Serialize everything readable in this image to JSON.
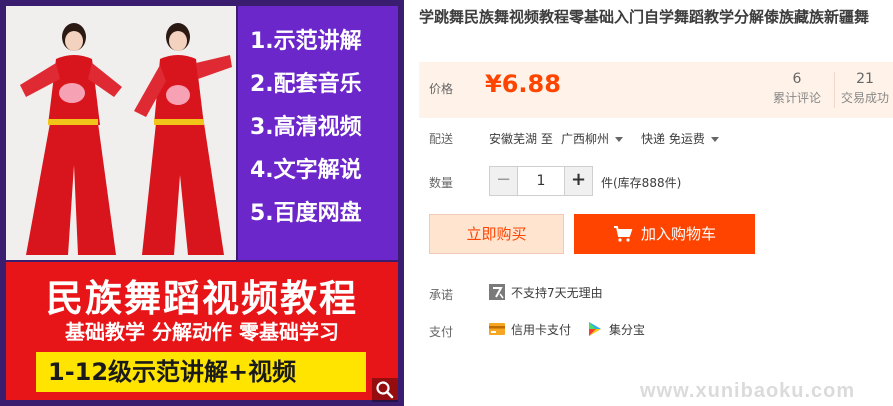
{
  "image": {
    "steps": [
      "1.示范讲解",
      "2.配套音乐",
      "3.高清视频",
      "4.文字解说",
      "5.百度网盘"
    ],
    "banner_title": "民族舞蹈视频教程",
    "banner_subtitle": "基础教学 分解动作 零基础学习",
    "banner_pill": "1-12级示范讲解+视频",
    "zoom_icon": "magnifier-icon"
  },
  "product": {
    "title": "学跳舞民族舞视频教程零基础入门自学舞蹈教学分解傣族藏族新疆舞",
    "price_label": "价格",
    "price": "¥6.88",
    "reviews_count": "6",
    "reviews_label": "累计评论",
    "sales_count": "21",
    "sales_label": "交易成功"
  },
  "shipping": {
    "label": "配送",
    "from": "安徽芜湖 至",
    "to": "广西柳州",
    "method": "快递 免运费"
  },
  "quantity": {
    "label": "数量",
    "value": "1",
    "minus": "−",
    "plus": "+",
    "stock": "件(库存888件)"
  },
  "actions": {
    "buy_now": "立即购买",
    "add_to_cart": "加入购物车"
  },
  "promise": {
    "label": "承诺",
    "text": "不支持7天无理由"
  },
  "payment": {
    "label": "支付",
    "card": "信用卡支付",
    "jifen": "集分宝"
  },
  "watermark": "www.xunibaoku.com",
  "colors": {
    "accent": "#ff4400",
    "price_bg": "#fff2e8",
    "image_purple": "#6b27c9",
    "banner_red": "#e71518",
    "banner_yellow": "#ffe400"
  }
}
